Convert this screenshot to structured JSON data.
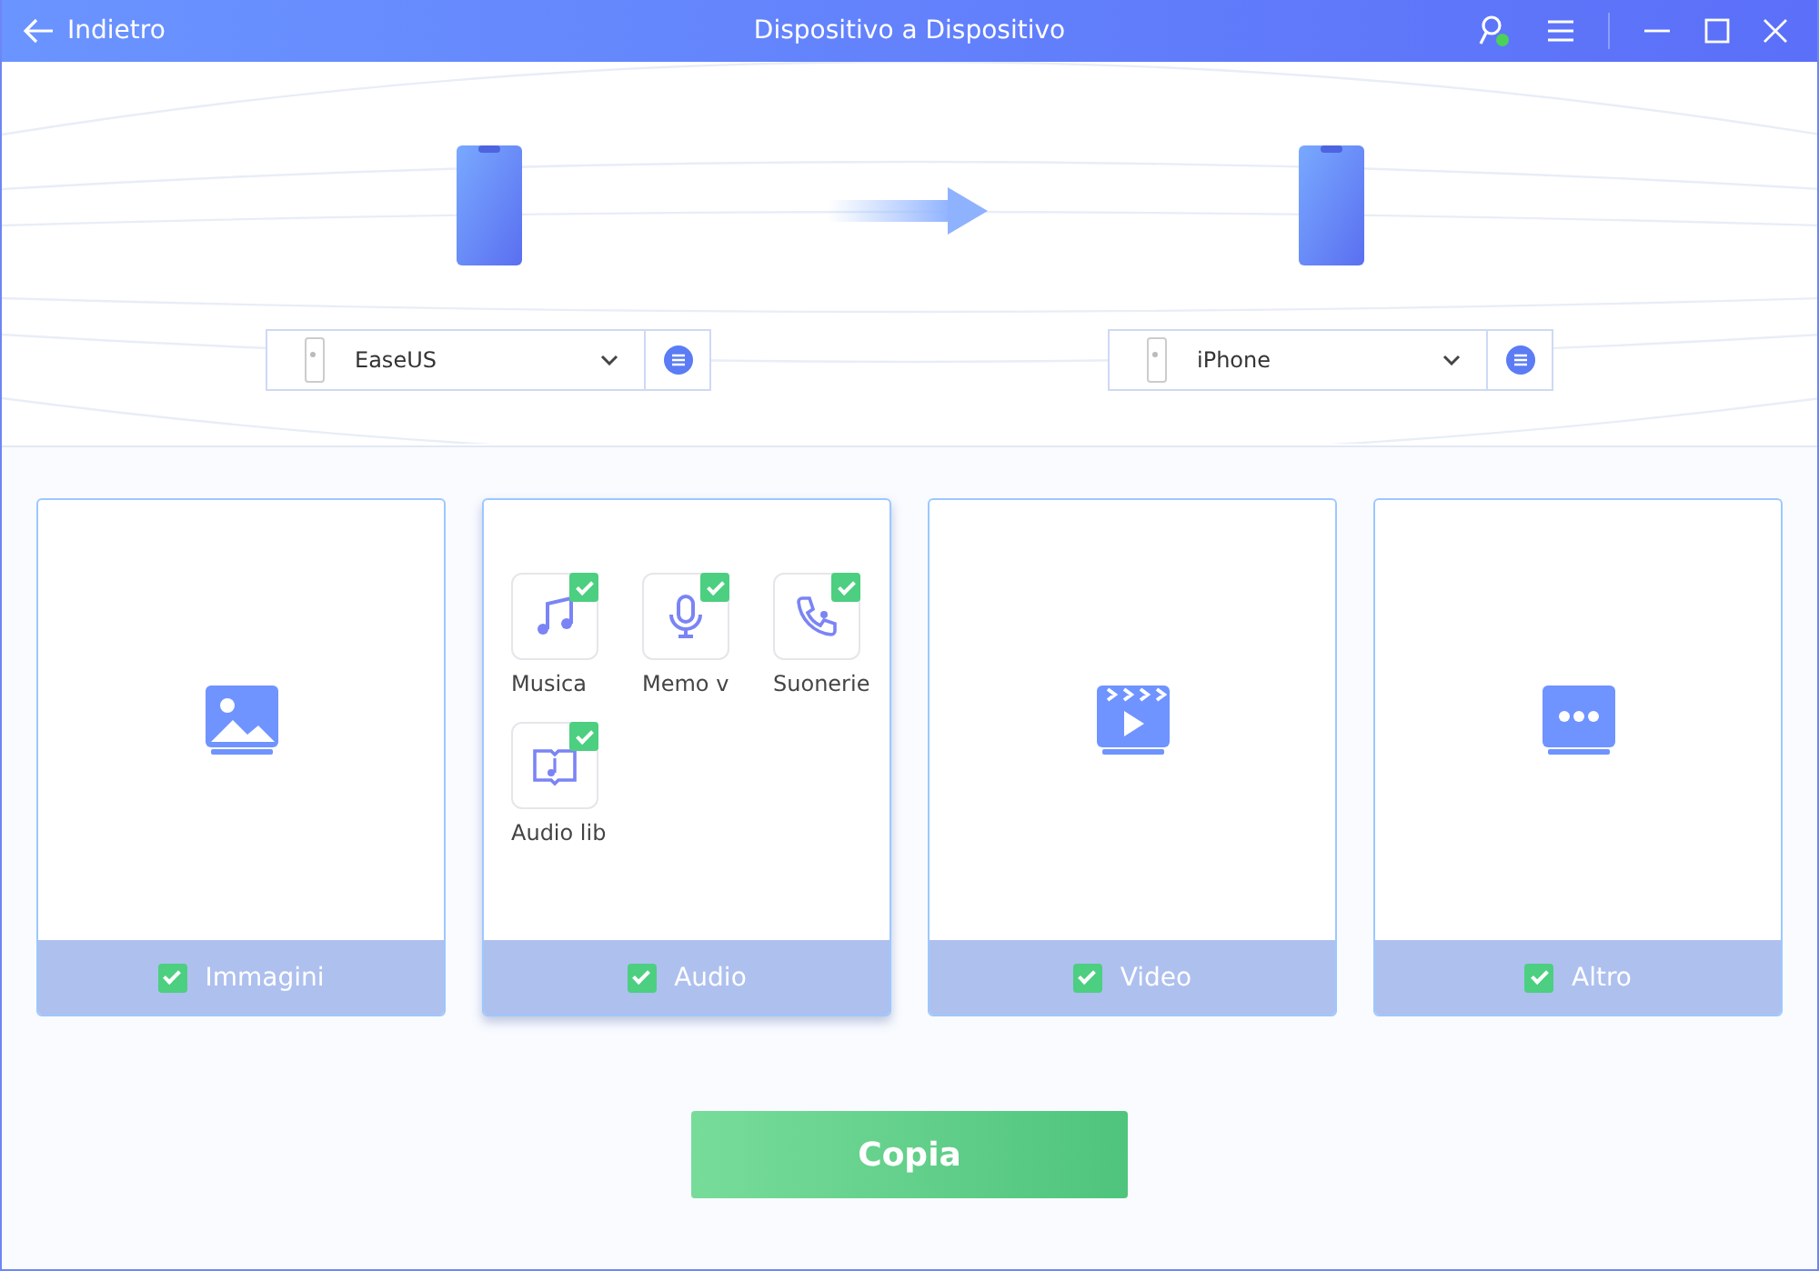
{
  "window": {
    "back": "Indietro",
    "title": "Dispositivo a Dispositivo"
  },
  "source": {
    "device": "EaseUS"
  },
  "target": {
    "device": "iPhone"
  },
  "categories": [
    {
      "kind": "image",
      "label": "Immagini",
      "checked": true,
      "selected": false
    },
    {
      "kind": "audio",
      "label": "Audio",
      "checked": true,
      "selected": true,
      "items": [
        {
          "kind": "music",
          "label": "Musica",
          "checked": true
        },
        {
          "kind": "voice",
          "label": "Memo v",
          "checked": true
        },
        {
          "kind": "ringtone",
          "label": "Suonerie",
          "checked": true
        },
        {
          "kind": "audiobook",
          "label": "Audio lib",
          "checked": true
        }
      ]
    },
    {
      "kind": "video",
      "label": "Video",
      "checked": true,
      "selected": false
    },
    {
      "kind": "other",
      "label": "Altro",
      "checked": true,
      "selected": false
    }
  ],
  "copy_button": "Copia"
}
